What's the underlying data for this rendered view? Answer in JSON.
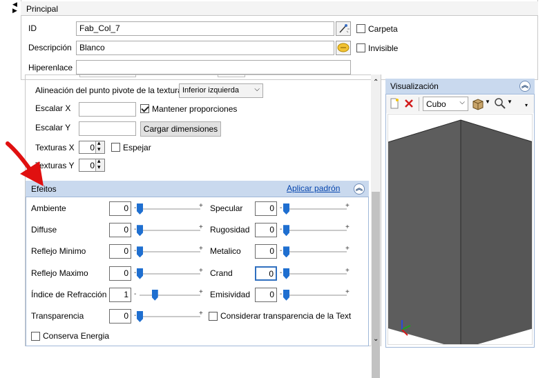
{
  "principal": {
    "title": "Principal",
    "id_label": "ID",
    "id_value": "Fab_Col_7",
    "carpeta_label": "Carpeta",
    "descripcion_label": "Descripción",
    "descripcion_value": "Blanco",
    "invisible_label": "Invisible",
    "hiperenlace_label": "Hiperenlace",
    "hiperenlace_value": ""
  },
  "texture": {
    "alignment_label": "Alineación del punto pivote de la textura",
    "alignment_value": "Inferior izquierda",
    "escalar_x_label": "Escalar X",
    "escalar_y_label": "Escalar Y",
    "mantener_label": "Mantener proporciones",
    "cargar_label": "Cargar dimensiones",
    "texturas_x_label": "Texturas X",
    "texturas_x_value": "0",
    "espejar_label": "Espejar",
    "texturas_y_label": "Texturas Y",
    "texturas_y_value": "0"
  },
  "efeitos": {
    "title": "Efeitos",
    "apply_default": "Aplicar padrón",
    "left": [
      {
        "label": "Ambiente",
        "value": "0",
        "level": 0.0
      },
      {
        "label": "Diffuse",
        "value": "0",
        "level": 0.0
      },
      {
        "label": "Reflejo Minimo",
        "value": "0",
        "level": 0.0
      },
      {
        "label": "Reflejo Maximo",
        "value": "0",
        "level": 0.0
      },
      {
        "label": "Índice de Refracción",
        "value": "1",
        "level": 0.25
      },
      {
        "label": "Transparencia",
        "value": "0",
        "level": 0.0
      }
    ],
    "right": [
      {
        "label": "Specular",
        "value": "0",
        "level": 0.0
      },
      {
        "label": "Rugosidad",
        "value": "0",
        "level": 0.0
      },
      {
        "label": "Metalico",
        "value": "0",
        "level": 0.0
      },
      {
        "label": "Crand",
        "value": "0",
        "level": 0.0
      },
      {
        "label": "Emisividad",
        "value": "0",
        "level": 0.0
      }
    ],
    "minus": "-",
    "plus": "+",
    "considerar_label": "Considerar transparencia de la Text",
    "conserva_label": "Conserva Energia"
  },
  "visualizacion": {
    "title": "Visualización",
    "shape_value": "Cubo",
    "shape_color": "#5c5c5c"
  },
  "colors": {
    "panel_header": "#c9d9ee",
    "accent": "#1f6fd0",
    "arrow_red": "#e01010"
  }
}
